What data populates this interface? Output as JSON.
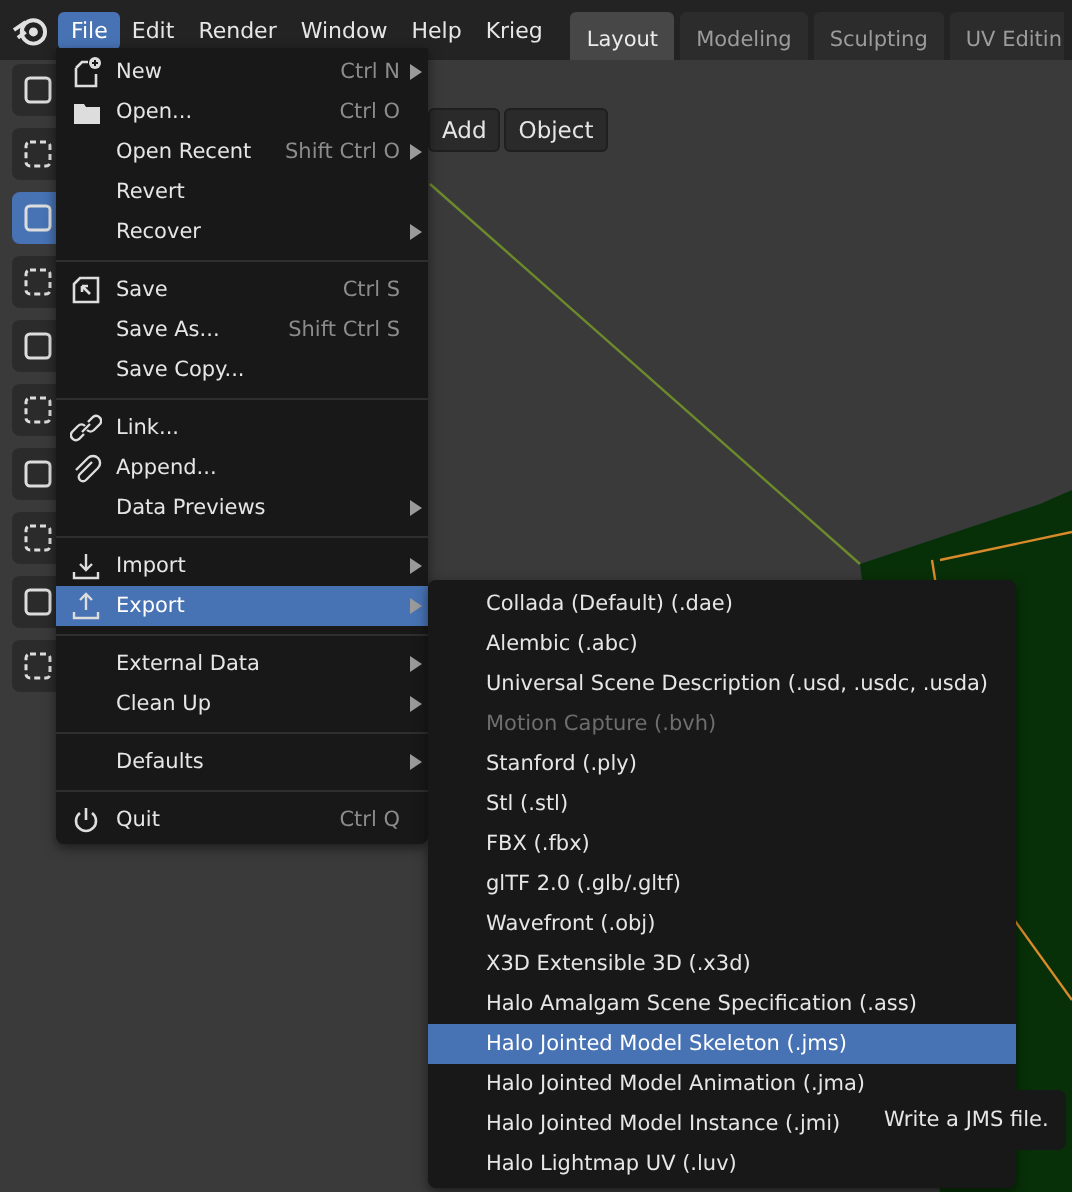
{
  "app_menu": [
    {
      "label": "File",
      "selected": true
    },
    {
      "label": "Edit",
      "selected": false
    },
    {
      "label": "Render",
      "selected": false
    },
    {
      "label": "Window",
      "selected": false
    },
    {
      "label": "Help",
      "selected": false
    },
    {
      "label": "Krieg",
      "selected": false
    }
  ],
  "workspace_tabs": [
    {
      "label": "Layout",
      "selected": true
    },
    {
      "label": "Modeling",
      "selected": false
    },
    {
      "label": "Sculpting",
      "selected": false
    },
    {
      "label": "UV Editin",
      "selected": false
    }
  ],
  "viewport_header": {
    "buttons": [
      "Add",
      "Object"
    ]
  },
  "file_menu": {
    "sections": [
      [
        {
          "kind": "new",
          "label": "New",
          "shortcut": "Ctrl N",
          "submenu": true,
          "selected": false
        },
        {
          "kind": "open",
          "label": "Open...",
          "shortcut": "Ctrl O",
          "submenu": false,
          "selected": false
        },
        {
          "kind": "plain",
          "label": "Open Recent",
          "shortcut": "Shift Ctrl O",
          "submenu": true,
          "selected": false
        },
        {
          "kind": "plain",
          "label": "Revert",
          "submenu": false,
          "selected": false
        },
        {
          "kind": "plain",
          "label": "Recover",
          "submenu": true,
          "selected": false
        }
      ],
      [
        {
          "kind": "save",
          "label": "Save",
          "shortcut": "Ctrl S",
          "submenu": false,
          "selected": false
        },
        {
          "kind": "plain",
          "label": "Save As...",
          "shortcut": "Shift Ctrl S",
          "submenu": false,
          "selected": false
        },
        {
          "kind": "plain",
          "label": "Save Copy...",
          "submenu": false,
          "selected": false
        }
      ],
      [
        {
          "kind": "link",
          "label": "Link...",
          "submenu": false,
          "selected": false
        },
        {
          "kind": "append",
          "label": "Append...",
          "submenu": false,
          "selected": false
        },
        {
          "kind": "plain",
          "label": "Data Previews",
          "submenu": true,
          "selected": false
        }
      ],
      [
        {
          "kind": "import",
          "label": "Import",
          "submenu": true,
          "selected": false
        },
        {
          "kind": "export",
          "label": "Export",
          "submenu": true,
          "selected": true
        }
      ],
      [
        {
          "kind": "plain",
          "label": "External Data",
          "submenu": true,
          "selected": false
        },
        {
          "kind": "plain",
          "label": "Clean Up",
          "submenu": true,
          "selected": false
        }
      ],
      [
        {
          "kind": "plain",
          "label": "Defaults",
          "submenu": true,
          "selected": false
        }
      ],
      [
        {
          "kind": "quit",
          "label": "Quit",
          "shortcut": "Ctrl Q",
          "submenu": false,
          "selected": false
        }
      ]
    ]
  },
  "export_menu": {
    "items": [
      {
        "label": "Collada (Default) (.dae)",
        "disabled": false,
        "selected": false
      },
      {
        "label": "Alembic (.abc)",
        "disabled": false,
        "selected": false
      },
      {
        "label": "Universal Scene Description (.usd, .usdc, .usda)",
        "disabled": false,
        "selected": false
      },
      {
        "label": "Motion Capture (.bvh)",
        "disabled": true,
        "selected": false
      },
      {
        "label": "Stanford (.ply)",
        "disabled": false,
        "selected": false
      },
      {
        "label": "Stl (.stl)",
        "disabled": false,
        "selected": false
      },
      {
        "label": "FBX (.fbx)",
        "disabled": false,
        "selected": false
      },
      {
        "label": "glTF 2.0 (.glb/.gltf)",
        "disabled": false,
        "selected": false
      },
      {
        "label": "Wavefront (.obj)",
        "disabled": false,
        "selected": false
      },
      {
        "label": "X3D Extensible 3D (.x3d)",
        "disabled": false,
        "selected": false
      },
      {
        "label": "Halo Amalgam Scene Specification (.ass)",
        "disabled": false,
        "selected": false
      },
      {
        "label": "Halo Jointed Model Skeleton (.jms)",
        "disabled": false,
        "selected": true
      },
      {
        "label": "Halo Jointed Model Animation (.jma)",
        "disabled": false,
        "selected": false
      },
      {
        "label": "Halo Jointed Model Instance (.jmi)",
        "disabled": false,
        "selected": false
      },
      {
        "label": "Halo Lightmap UV (.luv)",
        "disabled": false,
        "selected": false
      }
    ]
  },
  "tooltip": {
    "text": "Write a JMS file."
  }
}
